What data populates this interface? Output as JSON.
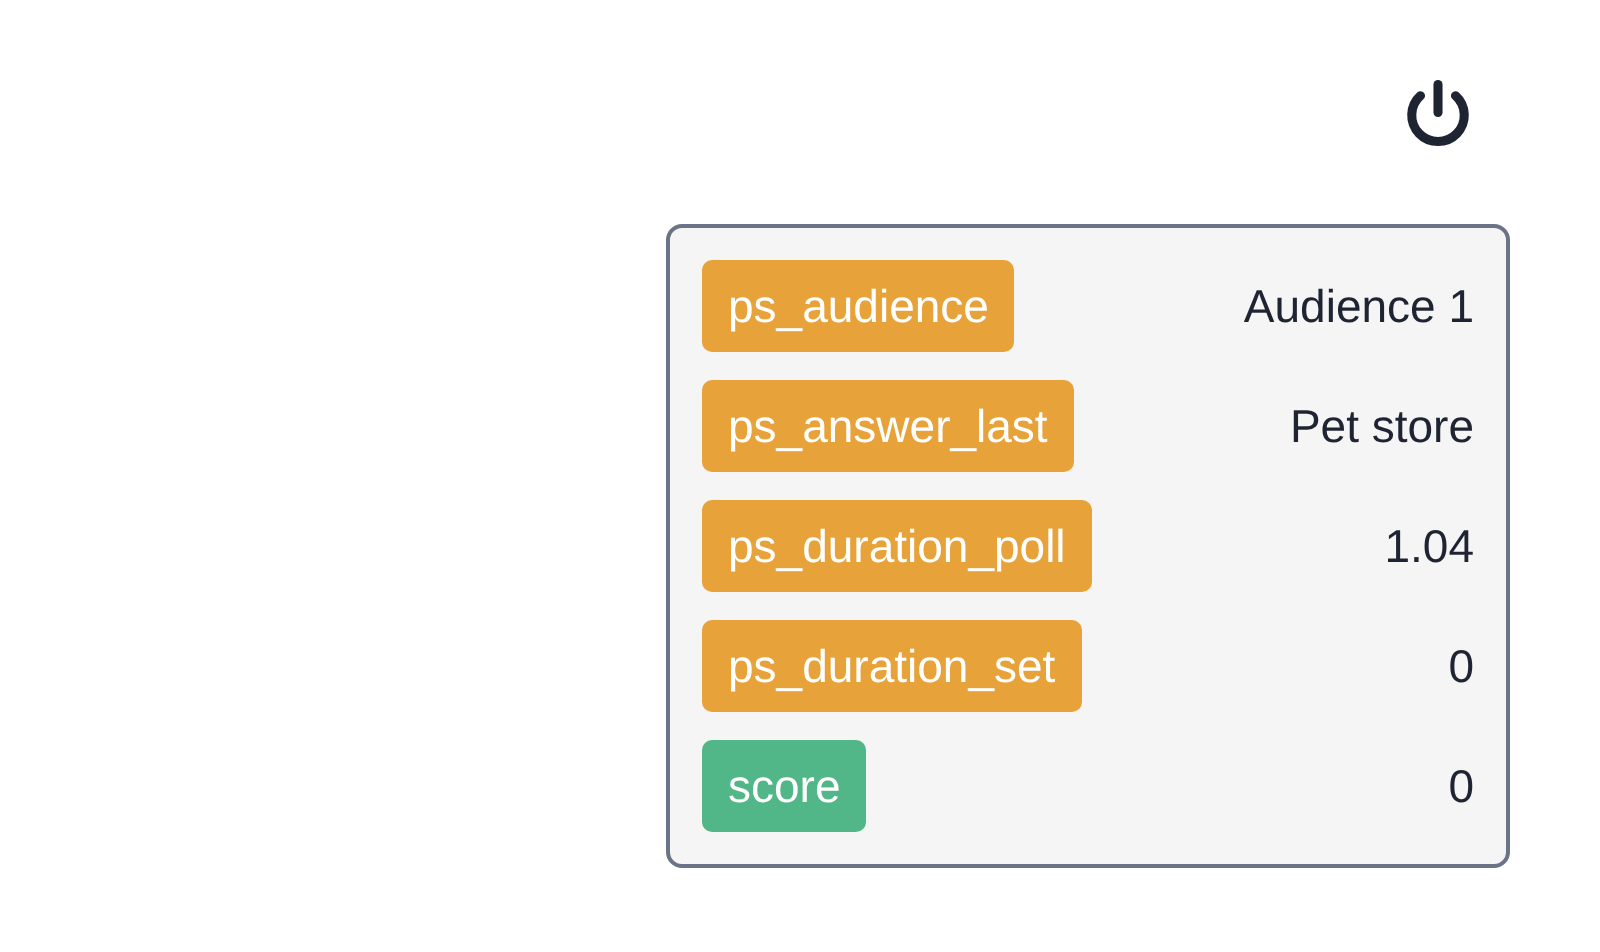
{
  "variables": [
    {
      "name": "ps_audience",
      "value": "Audience 1",
      "color": "#e8a23a"
    },
    {
      "name": "ps_answer_last",
      "value": "Pet store",
      "color": "#e8a23a"
    },
    {
      "name": "ps_duration_poll",
      "value": "1.04",
      "color": "#e8a23a"
    },
    {
      "name": "ps_duration_set",
      "value": "0",
      "color": "#e8a23a"
    },
    {
      "name": "score",
      "value": "0",
      "color": "#52b788"
    }
  ]
}
